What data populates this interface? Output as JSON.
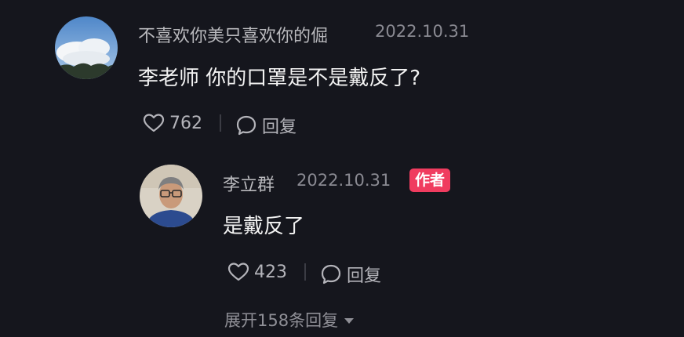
{
  "comment": {
    "username": "不喜欢你美只喜欢你的倔",
    "date": "2022.10.31",
    "text": "李老师 你的口罩是不是戴反了?",
    "likes": "762",
    "reply_label": "回复",
    "avatar_icon": "sky-clouds-avatar"
  },
  "reply": {
    "username": "李立群",
    "date": "2022.10.31",
    "author_badge": "作者",
    "text": "是戴反了",
    "likes": "423",
    "reply_label": "回复",
    "avatar_icon": "man-portrait-avatar"
  },
  "expand_label": "展开158条回复",
  "colors": {
    "background": "#15161d",
    "badge": "#f03c5f",
    "secondary_text": "#8a8a92"
  }
}
